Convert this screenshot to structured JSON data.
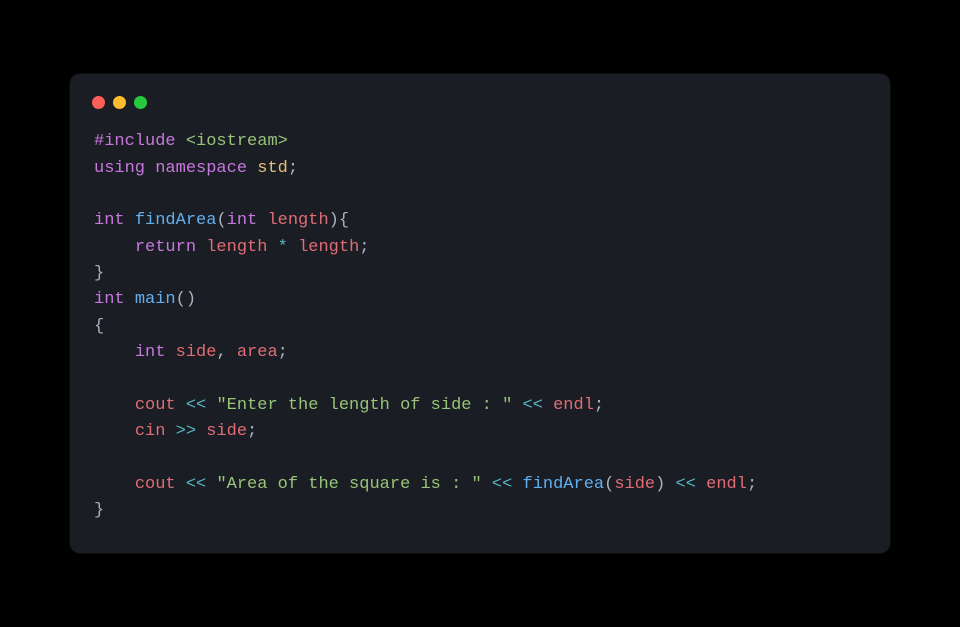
{
  "titlebar": {
    "close": "close",
    "minimize": "minimize",
    "zoom": "zoom"
  },
  "code": {
    "l1": {
      "a": "#include",
      "b": " <iostream>"
    },
    "l2": {
      "a": "using",
      "b": " ",
      "c": "namespace",
      "d": " ",
      "e": "std",
      "f": ";"
    },
    "l3": "",
    "l4": {
      "a": "int",
      "b": " ",
      "c": "findArea",
      "d": "(",
      "e": "int",
      "f": " ",
      "g": "length",
      "h": "){"
    },
    "l5": {
      "a": "    ",
      "b": "return",
      "c": " ",
      "d": "length",
      "e": " ",
      "f": "*",
      "g": " ",
      "h": "length",
      "i": ";"
    },
    "l6": {
      "a": "}"
    },
    "l7": {
      "a": "int",
      "b": " ",
      "c": "main",
      "d": "()"
    },
    "l8": {
      "a": "{"
    },
    "l9": {
      "a": "    ",
      "b": "int",
      "c": " ",
      "d": "side",
      "e": ", ",
      "f": "area",
      "g": ";"
    },
    "l10": "",
    "l11": {
      "a": "    ",
      "b": "cout",
      "c": " ",
      "d": "<<",
      "e": " ",
      "f": "\"Enter the length of side : \"",
      "g": " ",
      "h": "<<",
      "i": " ",
      "j": "endl",
      "k": ";"
    },
    "l12": {
      "a": "    ",
      "b": "cin",
      "c": " ",
      "d": ">>",
      "e": " ",
      "f": "side",
      "g": ";"
    },
    "l13": "",
    "l14": {
      "a": "    ",
      "b": "cout",
      "c": " ",
      "d": "<<",
      "e": " ",
      "f": "\"Area of the square is : \"",
      "g": " ",
      "h": "<<",
      "i": " ",
      "j": "findArea",
      "k": "(",
      "l": "side",
      "m": ") ",
      "n": "<<",
      "o": " ",
      "p": "endl",
      "q": ";"
    },
    "l15": {
      "a": "}"
    }
  }
}
